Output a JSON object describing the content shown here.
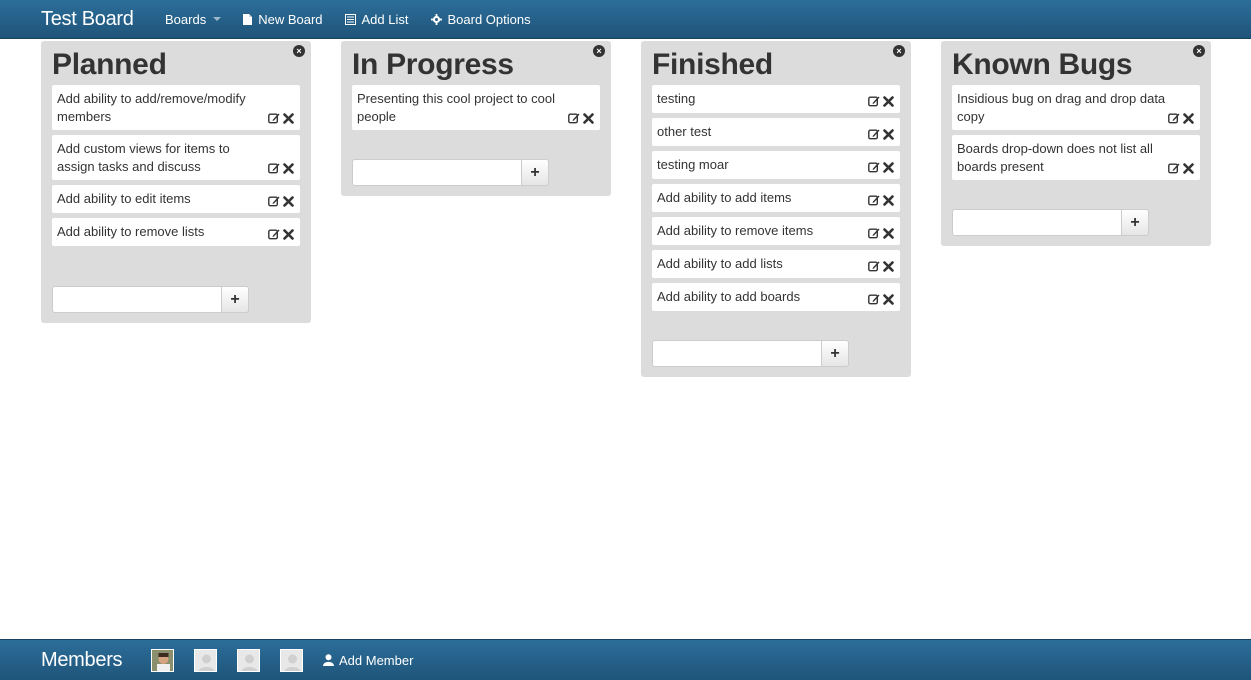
{
  "navbar": {
    "brand": "Test Board",
    "boards_label": "Boards",
    "new_board_label": "New Board",
    "add_list_label": "Add List",
    "board_options_label": "Board Options"
  },
  "lists": [
    {
      "title": "Planned",
      "cards": [
        "Add ability to add/remove/modify members",
        "Add custom views for items to assign tasks and discuss",
        "Add ability to edit items",
        "Add ability to remove lists"
      ]
    },
    {
      "title": "In Progress",
      "cards": [
        "Presenting this cool project to cool people"
      ]
    },
    {
      "title": "Finished",
      "cards": [
        "testing",
        "other test",
        "testing moar",
        "Add ability to add items",
        "Add ability to remove items",
        "Add ability to add lists",
        "Add ability to add boards"
      ]
    },
    {
      "title": "Known Bugs",
      "cards": [
        "Insidious bug on drag and drop data copy",
        "Boards drop-down does not list all boards present"
      ]
    }
  ],
  "footer": {
    "title": "Members",
    "add_member_label": "Add Member",
    "avatars": [
      "member-photo",
      "member-placeholder",
      "member-placeholder",
      "member-placeholder"
    ]
  },
  "icons": {
    "add": "+",
    "close": "×"
  },
  "colors": {
    "navbar": "#2c6e9a",
    "list_bg": "#dcdcdc",
    "card_bg": "#ffffff"
  }
}
